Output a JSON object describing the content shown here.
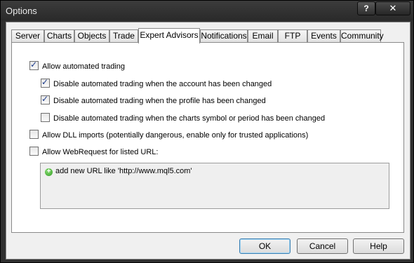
{
  "window": {
    "title": "Options",
    "help_glyph": "?",
    "close_glyph": "✕"
  },
  "tabs": [
    {
      "label": "Server"
    },
    {
      "label": "Charts"
    },
    {
      "label": "Objects"
    },
    {
      "label": "Trade"
    },
    {
      "label": "Expert Advisors",
      "active": true
    },
    {
      "label": "Notifications"
    },
    {
      "label": "Email"
    },
    {
      "label": "FTP"
    },
    {
      "label": "Events"
    },
    {
      "label": "Community"
    }
  ],
  "options": {
    "allow_automated": {
      "label": "Allow automated trading",
      "checked": true
    },
    "disable_account": {
      "label": "Disable automated trading when the account has been changed",
      "checked": true
    },
    "disable_profile": {
      "label": "Disable automated trading when the profile has been changed",
      "checked": true
    },
    "disable_symbol": {
      "label": "Disable automated trading when the charts symbol or period has been changed",
      "checked": false
    },
    "allow_dll": {
      "label": "Allow DLL imports (potentially dangerous, enable only for trusted applications)",
      "checked": false
    },
    "allow_webrequest": {
      "label": "Allow WebRequest for listed URL:",
      "checked": false
    }
  },
  "url_list": {
    "add_label": "add new URL like 'http://www.mql5.com'"
  },
  "buttons": {
    "ok": "OK",
    "cancel": "Cancel",
    "help": "Help"
  }
}
